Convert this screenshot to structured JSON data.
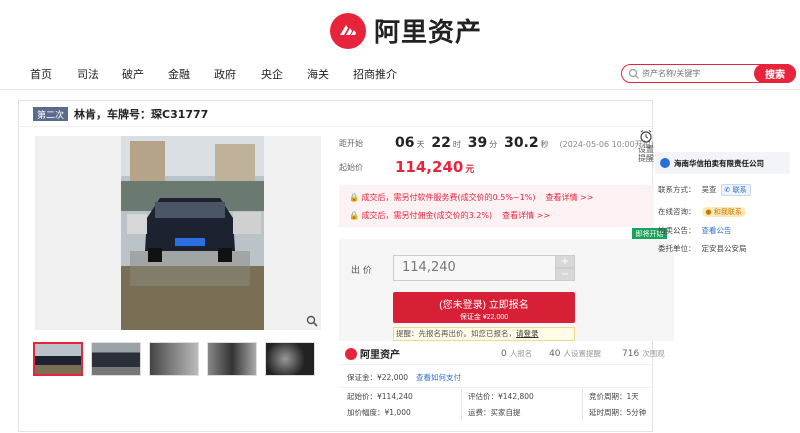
{
  "brand": {
    "name": "阿里资产",
    "accent": "#e8243c"
  },
  "nav": {
    "items": [
      "首页",
      "司法",
      "破产",
      "金融",
      "政府",
      "央企",
      "海关",
      "招商推介"
    ]
  },
  "search": {
    "placeholder": "资产名称/关键字",
    "button": "搜索"
  },
  "lot": {
    "round_badge": "第二次",
    "title": "林肯，车牌号：琛C31777"
  },
  "countdown": {
    "label": "距开始",
    "days": "06",
    "days_unit": "天",
    "hours": "22",
    "hours_unit": "时",
    "minutes": "39",
    "minutes_unit": "分",
    "seconds": "30.2",
    "seconds_unit": "秒",
    "start_time": "(2024-05-06 10:00开拍)"
  },
  "alarm": {
    "label": "设置提醒"
  },
  "price": {
    "label": "起始价",
    "value": "114,240",
    "unit": "元"
  },
  "fees": [
    {
      "text": "成交后，需另付软件服务费(成交价的0.5%~1%)",
      "link": "查看详情 >>"
    },
    {
      "text": "成交后，需另付佣金(成交价的3.2%)",
      "link": "查看详情 >>"
    }
  ],
  "green_tag": "即将开始",
  "bid": {
    "label": "出 价",
    "value": "114,240",
    "plus": "+",
    "minus": "−",
    "signup_main": "(您未登录) 立即报名",
    "signup_sub": "保证金 ¥22,000",
    "tip_text": "提醒：先报名再出价。如您已报名，",
    "tip_link": "请登录"
  },
  "stats": {
    "mini_brand": "阿里资产",
    "signups": "0",
    "signups_label": "人报名",
    "reminders": "40",
    "reminders_label": "人设置提醒",
    "views": "716",
    "views_label": "次围观"
  },
  "details": {
    "deposit": "保证金：¥22,000",
    "deposit_link": "查看如何支付",
    "start_price": "起始价：¥114,240",
    "eval_price": "评估价：¥142,800",
    "cycle": "竞价周期：1天",
    "increment": "加价幅度：¥1,000",
    "fee_note": "运费：买家自提",
    "delay": "延时周期：5分钟"
  },
  "seller": {
    "name": "海南华信拍卖有限责任公司",
    "contact_label": "联系方式：",
    "contact_name": "吴查",
    "contact_chip": "联系",
    "consult_label": "在线咨询：",
    "consult_chip": "和我联系",
    "notice_label": "拍卖公告：",
    "notice_link": "查看公告",
    "entrust_label": "委托单位：",
    "entrust_value": "定安县公安局"
  }
}
